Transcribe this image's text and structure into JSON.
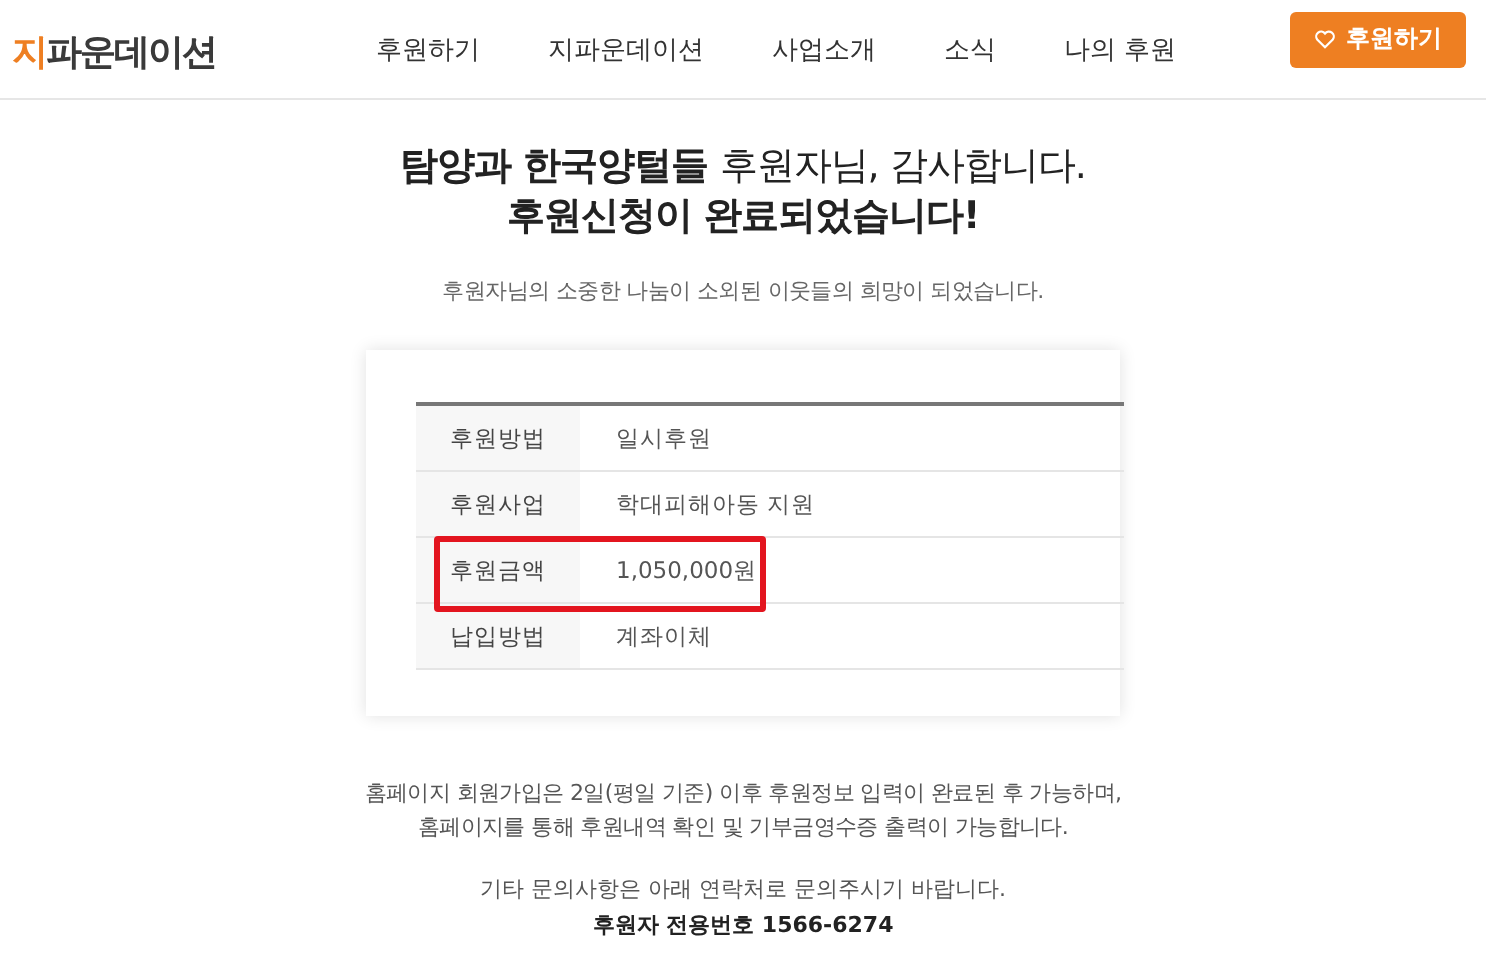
{
  "header": {
    "logo": {
      "accent": "지",
      "rest": "파운데이션"
    },
    "nav": [
      {
        "label": "후원하기"
      },
      {
        "label": "지파운데이션"
      },
      {
        "label": "사업소개"
      },
      {
        "label": "소식"
      },
      {
        "label": "나의 후원"
      }
    ],
    "cta_button": {
      "label": "후원하기"
    }
  },
  "headline": [
    "**탐양과 한국양털들** 후원자님, 감사합니다.",
    "후원신청이 완료되었습니다!"
  ],
  "subtitle": "후원자님의 소중한 나눔이 소외된 이웃들의 희망이 되었습니다.",
  "details": [
    {
      "label": "후원방법",
      "value": "일시후원",
      "highlighted": false
    },
    {
      "label": "후원사업",
      "value": "학대피해아동 지원",
      "highlighted": false
    },
    {
      "label": "후원금액",
      "value": "1,050,000원",
      "highlighted": true
    },
    {
      "label": "납입방법",
      "value": "계좌이체",
      "highlighted": false
    }
  ],
  "notice": [
    "홈페이지 회원가입은 2일(평일 기준) 이후 후원정보 입력이 완료된 후 가능하며,",
    "홈페이지를 통해 후원내역 확인 및 기부금영수증 출력이 가능합니다."
  ],
  "contact": {
    "text": "기타 문의사항은 아래 연락처로 문의주시기 바랍니다.",
    "phone": "후원자 전용번호 1566-6274"
  }
}
